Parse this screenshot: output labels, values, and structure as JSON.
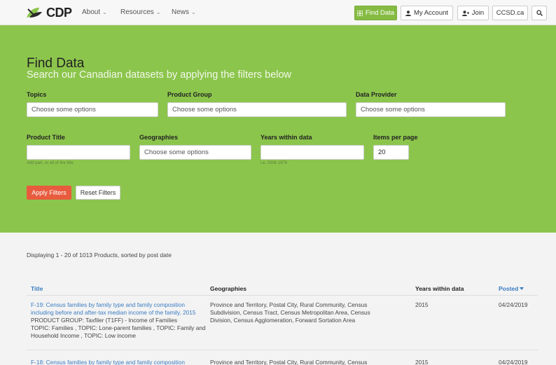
{
  "nav": {
    "logo_text": "CDP",
    "links": [
      "About",
      "Resources",
      "News"
    ],
    "find_data": "Find Data",
    "my_account": "My Account",
    "join": "Join",
    "ccsd": "CCSD.ca"
  },
  "hero": {
    "title": "Find Data",
    "subtitle": "Search our Canadian datasets by applying the filters below",
    "filters": {
      "topics_label": "Topics",
      "topics_placeholder": "Choose some options",
      "product_group_label": "Product Group",
      "product_group_placeholder": "Choose some options",
      "data_provider_label": "Data Provider",
      "data_provider_placeholder": "Choose some options",
      "product_title_label": "Product Title",
      "product_title_hint": "Add part, or all of the title",
      "geographies_label": "Geographies",
      "geographies_placeholder": "Choose some options",
      "years_label": "Years within data",
      "years_hint": "i.e. 2006 1976",
      "items_label": "Items per page",
      "items_value": "20"
    },
    "apply": "Apply Filters",
    "reset": "Reset Filters"
  },
  "results": {
    "summary": "Displaying 1 - 20 of 1013 Products, sorted by post date",
    "headers": {
      "title": "Title",
      "geographies": "Geographies",
      "years": "Years within data",
      "posted": "Posted"
    },
    "rows": [
      {
        "title": "F-19: Census families by family type and family composition including before and after-tax median income of the family, 2015",
        "product_group": "PRODUCT GROUP: Taxfiler (T1FF) - Income of Families",
        "topics": "TOPIC: Families , TOPIC: Lone-parent families , TOPIC: Family and Household Income , TOPIC: Low income",
        "geographies": "Province and Territory, Postal City, Rural Community, Census Subdivision, Census Tract, Census Metropolitan Area, Census Division, Census Agglomeration, Forward Sortation Area",
        "years": "2015",
        "posted": "04/24/2019"
      },
      {
        "title": "F-18: Census families by family type and family composition",
        "geographies": "Province and Territory, Postal City, Rural Community, Census",
        "years": "2015",
        "posted": "04/24/2019"
      }
    ]
  }
}
